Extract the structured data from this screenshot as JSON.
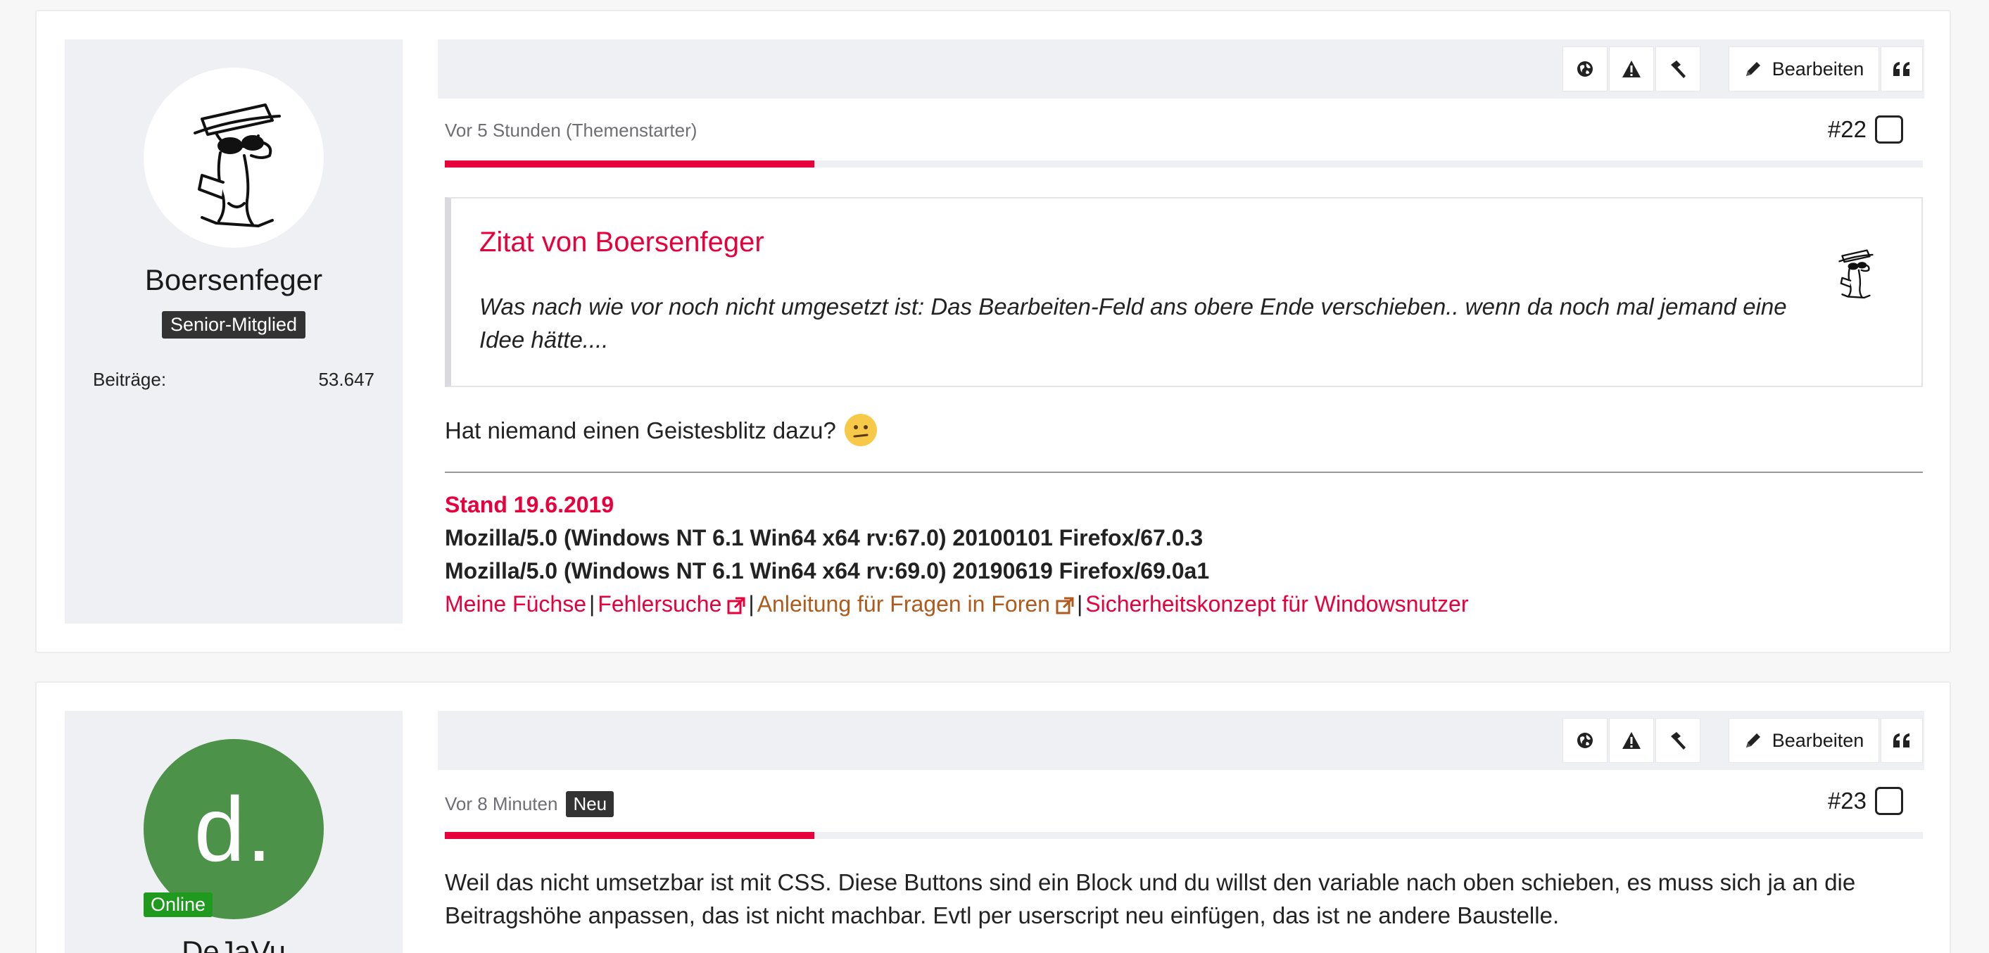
{
  "posts": [
    {
      "author": {
        "name": "Boersenfeger",
        "rank": "Senior-Mitglied",
        "stat_label": "Beiträge:",
        "stat_value": "53.647"
      },
      "toolbar": {
        "edit_label": "Bearbeiten"
      },
      "meta": {
        "time": "Vor 5 Stunden (Themenstarter)",
        "number": "#22"
      },
      "reading_progress": 0.25,
      "quote": {
        "title": "Zitat von Boersenfeger",
        "text": "Was nach wie vor noch nicht umgesetzt ist: Das Bearbeiten-Feld ans obere Ende verschieben.. wenn da noch mal jemand eine Idee hätte...."
      },
      "reply": "Hat niemand einen Geistesblitz dazu?",
      "signature": {
        "stand": "Stand 19.6.2019",
        "ua1": "Mozilla/5.0 (Windows NT 6.1 Win64 x64 rv:67.0) 20100101 Firefox/67.0.3",
        "ua2": "Mozilla/5.0 (Windows NT 6.1 Win64 x64 rv:69.0) 20190619 Firefox/69.0a1",
        "links": [
          "Meine Füchse",
          "Fehlersuche",
          "Anleitung für Fragen in Foren",
          "Sicherheitskonzept für Windowsnutzer"
        ],
        "separator": "|"
      }
    },
    {
      "author": {
        "name": "DeJaVu",
        "avatar_letter": "d.",
        "status": "Online"
      },
      "toolbar": {
        "edit_label": "Bearbeiten"
      },
      "meta": {
        "time": "Vor 8 Minuten",
        "badge": "Neu",
        "number": "#23"
      },
      "reading_progress": 0.25,
      "text": "Weil das nicht umsetzbar ist mit CSS. Diese Buttons sind ein Block und du willst den variable nach oben schieben, es muss sich ja an die Beitragshöhe anpassen, das ist nicht machbar. Evtl per userscript neu einfügen, das ist ne andere Baustelle."
    }
  ],
  "colors": {
    "accent": "#e8003c",
    "link_alt": "#b05a1c",
    "online": "#1f9a1f",
    "avatar_green": "#4c9249"
  },
  "icons": [
    "globe-icon",
    "warning-icon",
    "hammer-icon",
    "pencil-icon",
    "quote-icon",
    "external-link-icon",
    "confused-emoji-icon"
  ]
}
